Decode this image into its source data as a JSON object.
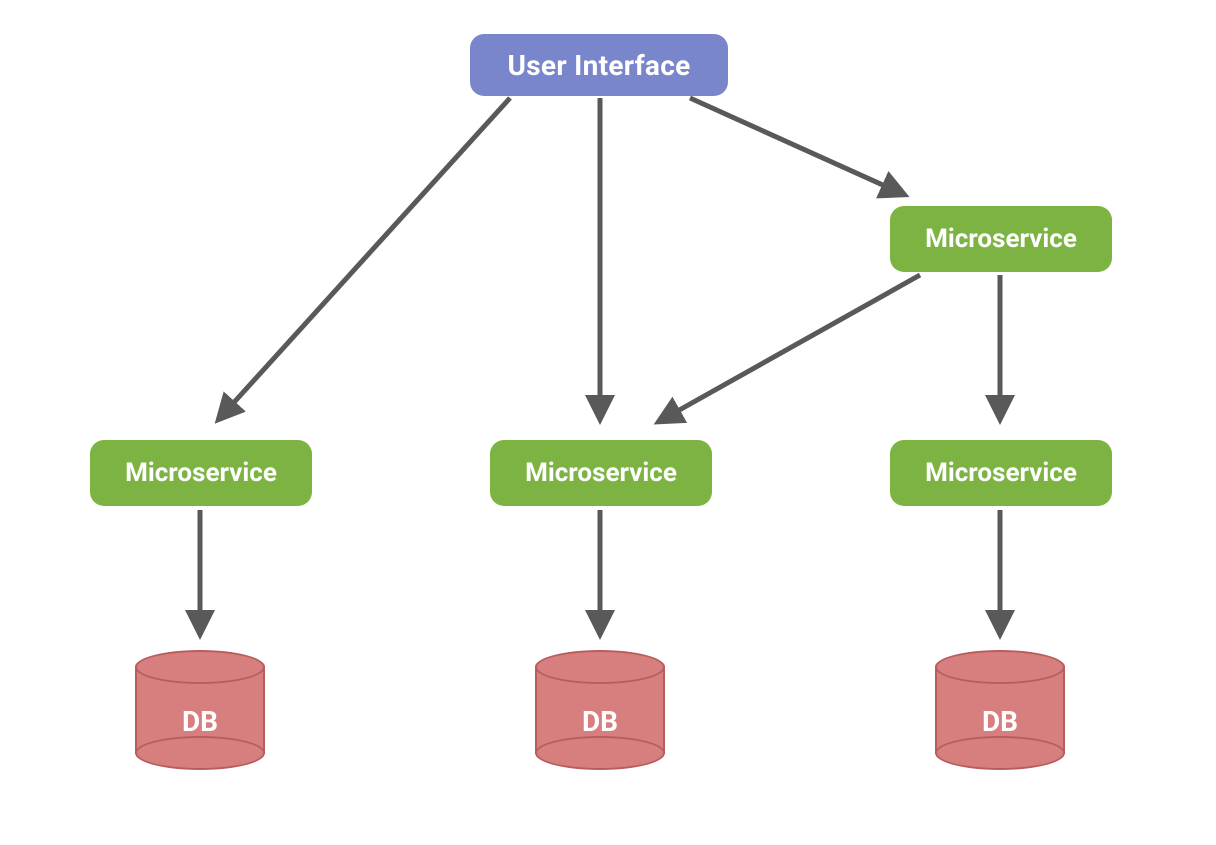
{
  "nodes": {
    "ui": {
      "label": "User Interface",
      "color": "#7986cb"
    },
    "ms_top_right": {
      "label": "Microservice",
      "color": "#7cb342"
    },
    "ms_left": {
      "label": "Microservice",
      "color": "#7cb342"
    },
    "ms_center": {
      "label": "Microservice",
      "color": "#7cb342"
    },
    "ms_right": {
      "label": "Microservice",
      "color": "#7cb342"
    },
    "db_left": {
      "label": "DB",
      "color": "#d77e7e"
    },
    "db_center": {
      "label": "DB",
      "color": "#d77e7e"
    },
    "db_right": {
      "label": "DB",
      "color": "#d77e7e"
    }
  },
  "arrows": {
    "color": "#595959",
    "width": 5
  },
  "edges": [
    {
      "from": "ui",
      "to": "ms_left"
    },
    {
      "from": "ui",
      "to": "ms_center"
    },
    {
      "from": "ui",
      "to": "ms_top_right"
    },
    {
      "from": "ms_top_right",
      "to": "ms_center"
    },
    {
      "from": "ms_top_right",
      "to": "ms_right"
    },
    {
      "from": "ms_left",
      "to": "db_left"
    },
    {
      "from": "ms_center",
      "to": "db_center"
    },
    {
      "from": "ms_right",
      "to": "db_right"
    }
  ]
}
